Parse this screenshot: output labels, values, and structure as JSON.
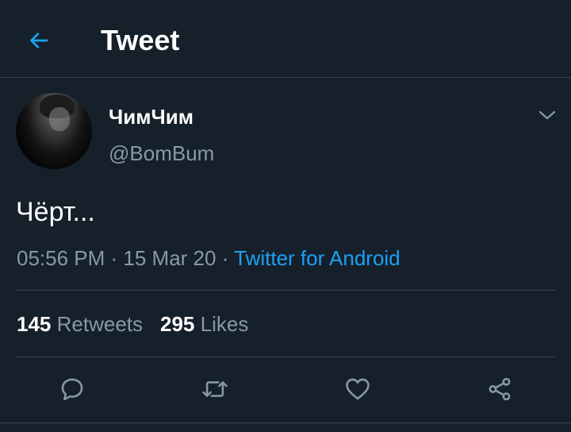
{
  "header": {
    "title": "Tweet",
    "back_icon": "arrow-left-icon"
  },
  "tweet": {
    "author": {
      "display_name": "ЧимЧим",
      "handle": "@BomBum"
    },
    "text": "Чёрт...",
    "time": "05:56 PM",
    "date": "15 Mar 20",
    "separator": " · ",
    "source": "Twitter for Android"
  },
  "stats": {
    "retweets_count": "145",
    "retweets_label": "Retweets",
    "likes_count": "295",
    "likes_label": "Likes"
  },
  "actions": [
    "reply-icon",
    "retweet-icon",
    "like-icon",
    "share-icon"
  ],
  "colors": {
    "background": "#15202b",
    "accent": "#1da1f2",
    "secondary_text": "#8899a6",
    "divider": "#38444d"
  }
}
